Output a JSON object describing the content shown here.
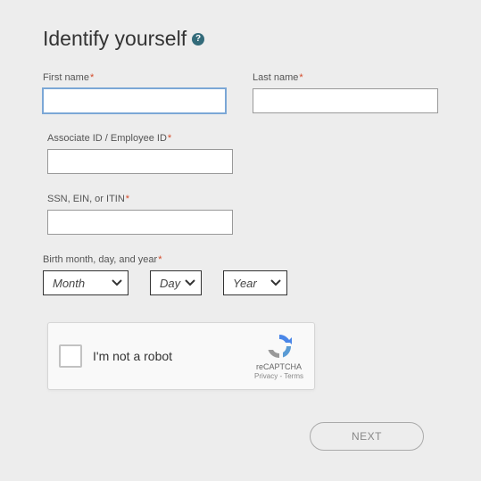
{
  "heading": "Identify yourself",
  "required_marker": "*",
  "fields": {
    "first_name": {
      "label": "First name",
      "value": ""
    },
    "last_name": {
      "label": "Last name",
      "value": ""
    },
    "associate_id": {
      "label": "Associate ID / Employee ID",
      "value": ""
    },
    "ssn": {
      "label": "SSN, EIN, or ITIN",
      "value": ""
    },
    "birth": {
      "label": "Birth month, day, and year",
      "month": "Month",
      "day": "Day",
      "year": "Year"
    }
  },
  "recaptcha": {
    "label": "I'm not a robot",
    "brand": "reCAPTCHA",
    "links": "Privacy - Terms"
  },
  "buttons": {
    "next": "NEXT"
  }
}
